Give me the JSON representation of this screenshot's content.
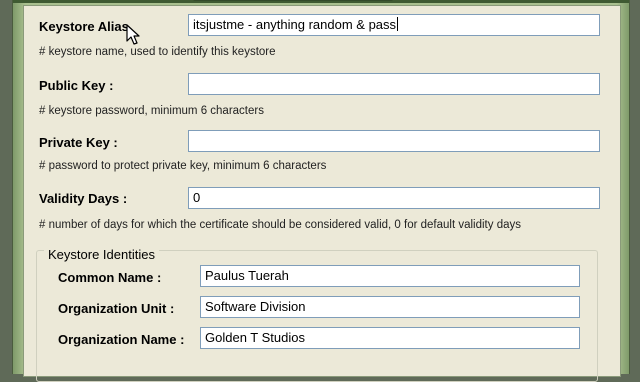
{
  "form": {
    "keystore_alias": {
      "label": "Keystore Alias",
      "value": "itsjustme - anything random & pass",
      "note": "# keystore name, used to identify this keystore"
    },
    "public_key": {
      "label": "Public Key :",
      "value": "",
      "note": "# keystore password, minimum 6 characters"
    },
    "private_key": {
      "label": "Private Key :",
      "value": "",
      "note": "# password to protect private key, minimum 6 characters"
    },
    "validity_days": {
      "label": "Validity Days :",
      "value": "0",
      "note": "# number of days for which the certificate should be considered valid, 0 for default validity days"
    }
  },
  "identities": {
    "title": "Keystore Identities",
    "common_name": {
      "label": "Common Name :",
      "value": "Paulus Tuerah"
    },
    "organization_unit": {
      "label": "Organization Unit :",
      "value": "Software Division"
    },
    "organization_name": {
      "label": "Organization Name :",
      "value": "Golden T Studios"
    }
  },
  "colors": {
    "window_frame": "#a9c08f",
    "client_bg": "#ece9d8",
    "field_border": "#7f9db9"
  },
  "icons": [
    "mouse-pointer-icon"
  ]
}
